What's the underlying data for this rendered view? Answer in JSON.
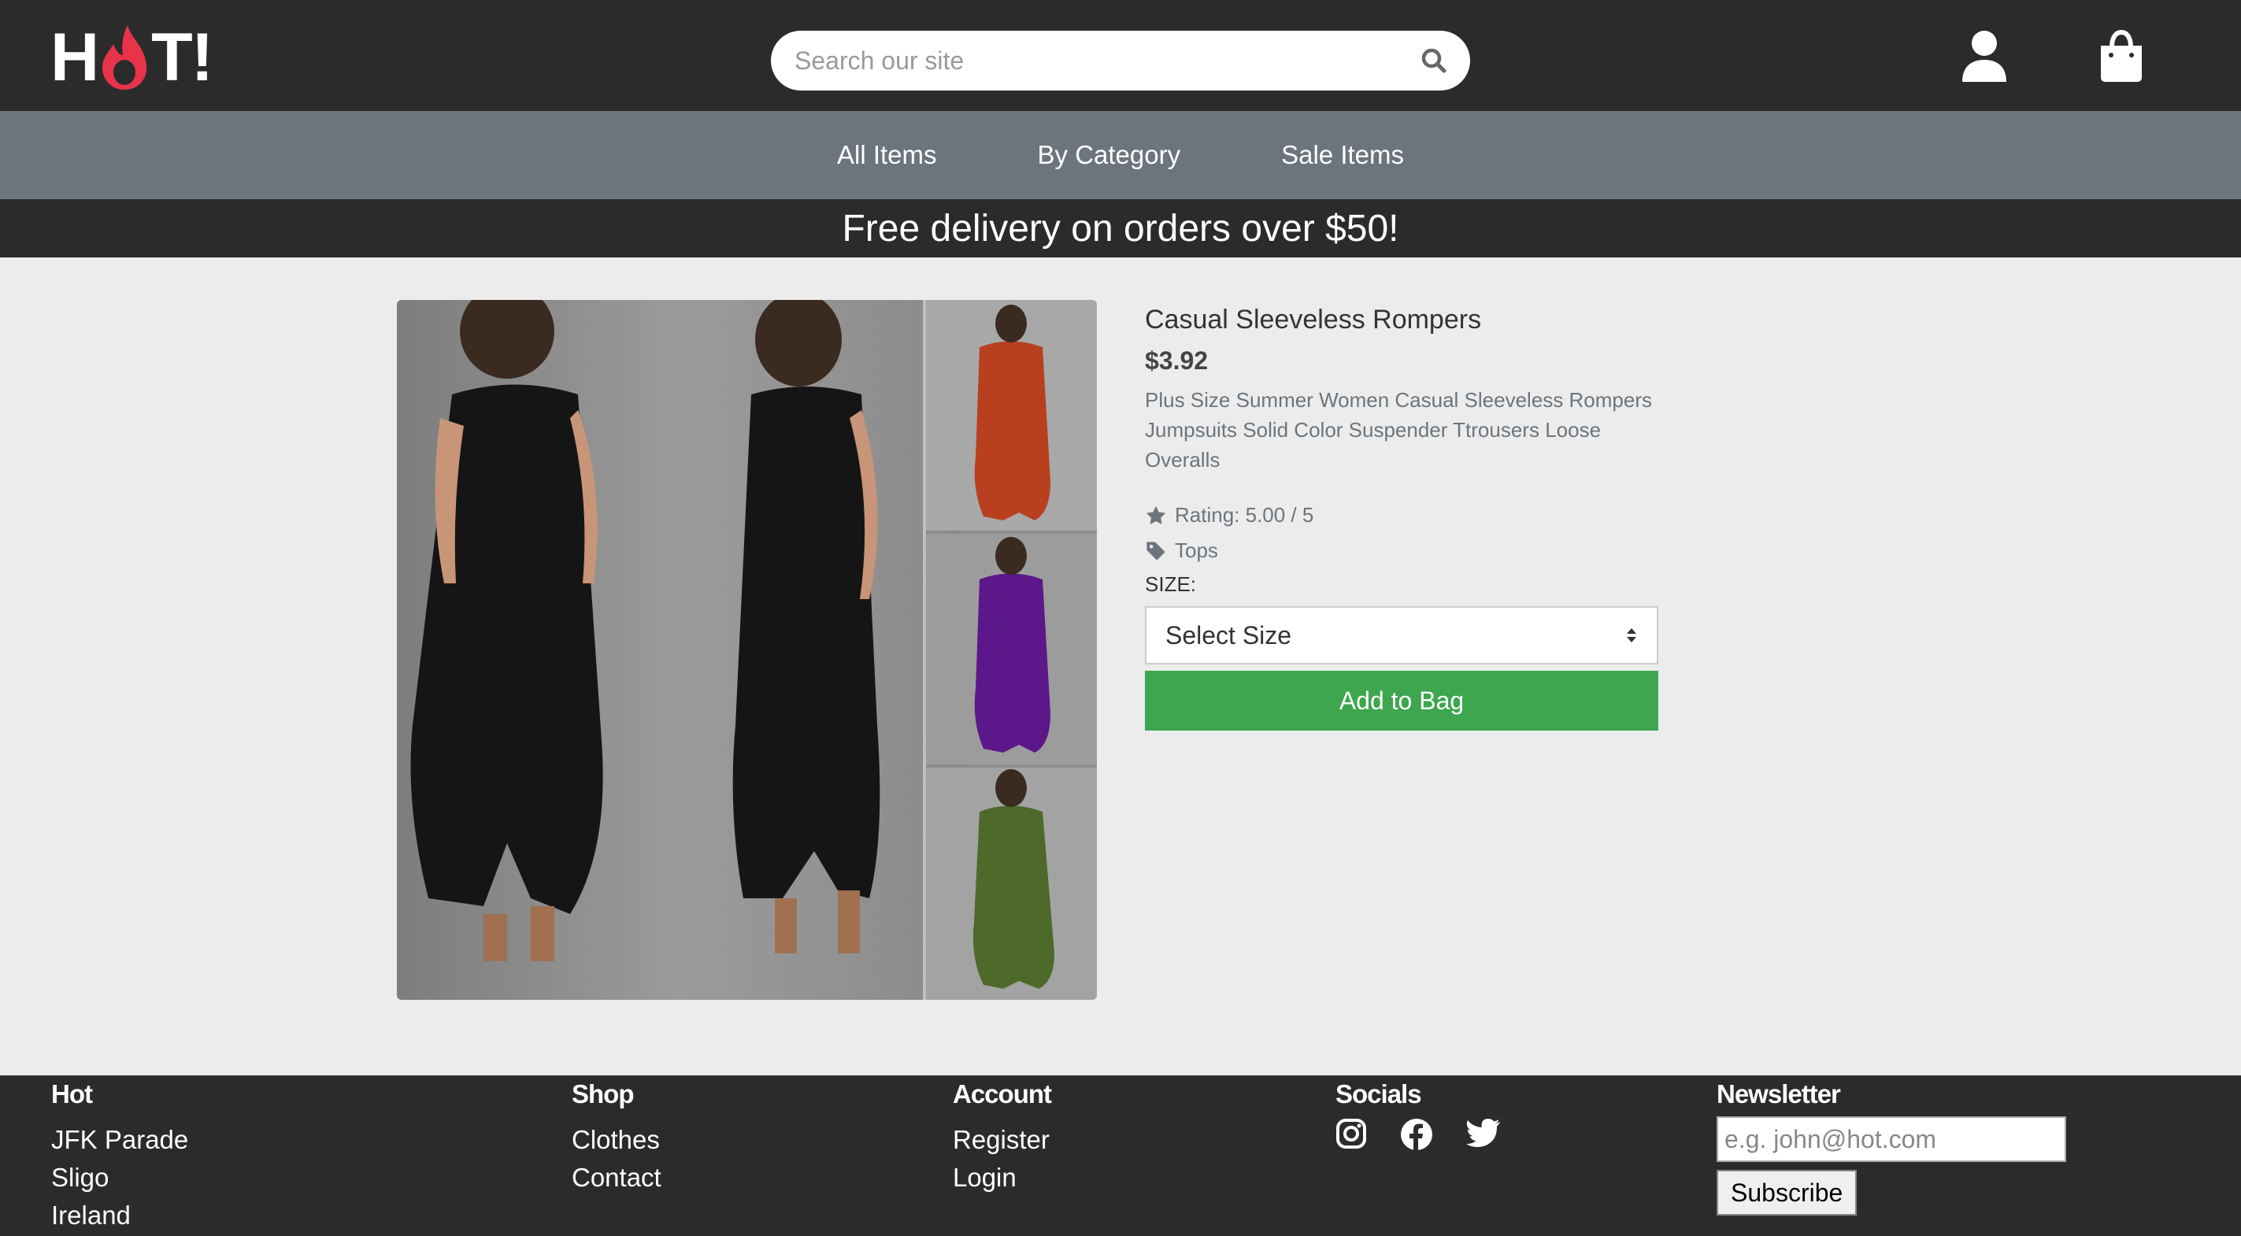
{
  "header": {
    "logo_left": "H",
    "logo_right": "T!",
    "search_placeholder": "Search our site"
  },
  "nav": {
    "items": [
      "All Items",
      "By Category",
      "Sale Items"
    ]
  },
  "promo": "Free delivery on orders over $50!",
  "product": {
    "title": "Casual Sleeveless Rompers",
    "price": "$3.92",
    "description": "Plus Size Summer Women Casual Sleeveless Rompers Jumpsuits Solid Color Suspender Ttrousers Loose Overalls",
    "rating": "Rating: 5.00 / 5",
    "category": "Tops",
    "size_label": "SIZE:",
    "size_select": "Select Size",
    "add_button": "Add to Bag"
  },
  "footer": {
    "hot": {
      "heading": "Hot",
      "lines": [
        "JFK Parade",
        "Sligo",
        "Ireland"
      ]
    },
    "shop": {
      "heading": "Shop",
      "links": [
        "Clothes",
        "Contact"
      ]
    },
    "account": {
      "heading": "Account",
      "links": [
        "Register",
        "Login"
      ]
    },
    "socials": {
      "heading": "Socials",
      "icons": [
        "instagram-icon",
        "facebook-icon",
        "twitter-icon"
      ]
    },
    "newsletter": {
      "heading": "Newsletter",
      "placeholder": "e.g. john@hot.com",
      "button": "Subscribe"
    }
  },
  "colors": {
    "header_bg": "#2b2b2b",
    "nav_bg": "#6c757d",
    "page_bg": "#ececec",
    "accent_button": "#3da64e",
    "logo_flame": "#e8334a"
  }
}
